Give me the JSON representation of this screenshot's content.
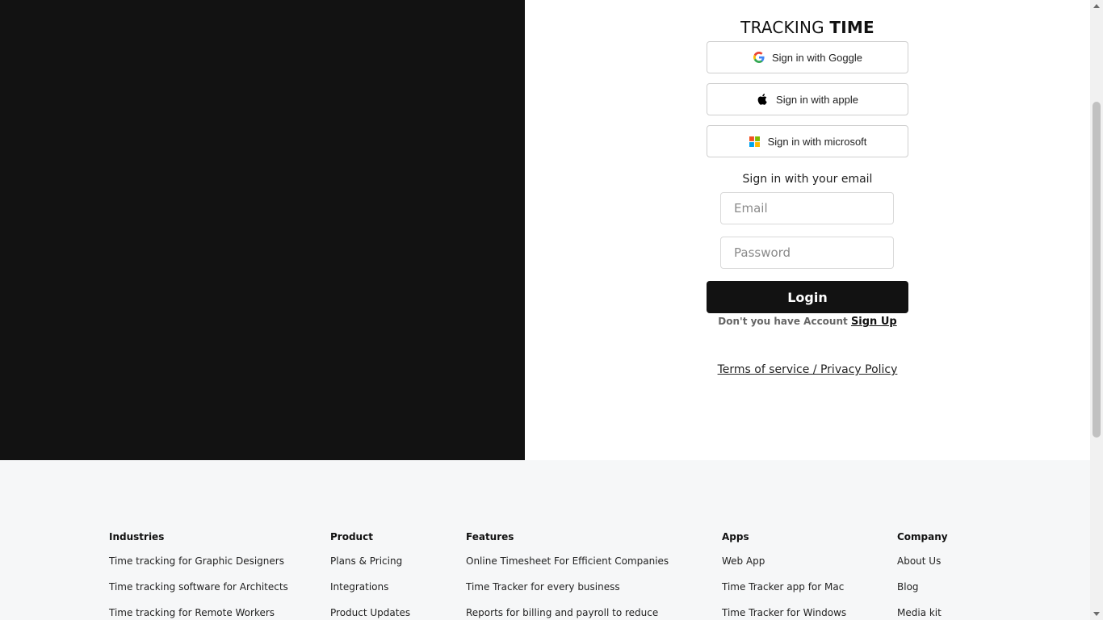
{
  "logo": {
    "light": "TRACKING",
    "bold": "TIME"
  },
  "sso": {
    "google_label": "Sign in with Goggle",
    "apple_label": "Sign in with apple",
    "microsoft_label": "Sign in with microsoft"
  },
  "email_form": {
    "heading": "Sign in with your email",
    "email_placeholder": "Email",
    "password_placeholder": "Password",
    "login_label": "Login",
    "no_account_text": "Don't you have Account",
    "signup_label": "Sign Up"
  },
  "terms_label": "Terms of service / Privacy Policy",
  "footer": {
    "industries": {
      "heading": "Industries",
      "items": [
        "Time tracking for Graphic Designers",
        "Time tracking software for Architects",
        "Time tracking for Remote Workers"
      ]
    },
    "product": {
      "heading": "Product",
      "items": [
        "Plans & Pricing",
        "Integrations",
        "Product Updates"
      ]
    },
    "features": {
      "heading": "Features",
      "items": [
        "Online Timesheet For Efficient Companies",
        "Time Tracker for every business",
        "Reports for billing and payroll to reduce"
      ]
    },
    "apps": {
      "heading": "Apps",
      "items": [
        "Web App",
        "Time Tracker app for Mac",
        "Time Tracker for Windows"
      ]
    },
    "company": {
      "heading": "Company",
      "items": [
        "About Us",
        "Blog",
        "Media kit"
      ]
    }
  },
  "colors": {
    "dark": "#121212",
    "footer_bg": "#f6f7f8",
    "ms_red": "#f25022",
    "ms_green": "#7fba00",
    "ms_blue": "#00a4ef",
    "ms_yellow": "#ffb900"
  },
  "icons": {
    "google": "google-logo-icon",
    "apple": "apple-logo-icon",
    "microsoft": "microsoft-logo-icon"
  }
}
